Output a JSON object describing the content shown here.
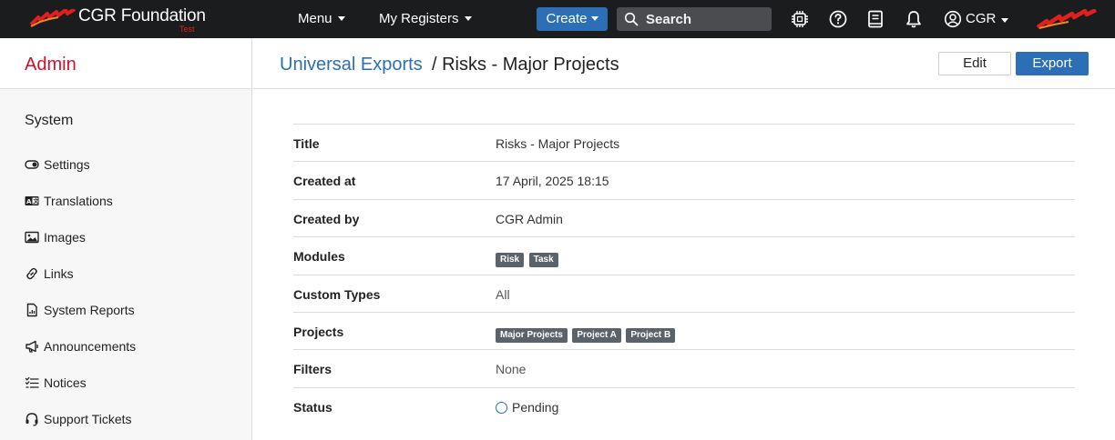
{
  "app": {
    "brand_name": "CGR Foundation",
    "brand_env": "Test",
    "colors": {
      "accent": "#2c6fb7",
      "brand_red": "#d0112b",
      "navbar": "#1b1c1e",
      "badge": "#5b6269"
    }
  },
  "navbar": {
    "menu_label": "Menu",
    "registers_label": "My Registers",
    "create_label": "Create",
    "search_label": "Search",
    "user_label": "CGR",
    "icons": [
      "chip-icon",
      "help-icon",
      "book-icon",
      "bell-icon",
      "user-circle-icon"
    ]
  },
  "sidebar": {
    "title": "Admin",
    "section": "System",
    "items": [
      {
        "label": "Settings",
        "icon": "toggle-icon"
      },
      {
        "label": "Translations",
        "icon": "translate-icon"
      },
      {
        "label": "Images",
        "icon": "image-icon"
      },
      {
        "label": "Links",
        "icon": "link-icon"
      },
      {
        "label": "System Reports",
        "icon": "report-icon"
      },
      {
        "label": "Announcements",
        "icon": "megaphone-icon"
      },
      {
        "label": "Notices",
        "icon": "checklist-icon"
      },
      {
        "label": "Support Tickets",
        "icon": "headset-icon"
      }
    ]
  },
  "header": {
    "breadcrumb_link": "Universal Exports",
    "breadcrumb_current": "/ Risks - Major Projects",
    "edit_label": "Edit",
    "export_label": "Export"
  },
  "details": {
    "title": {
      "label": "Title",
      "value": "Risks - Major Projects"
    },
    "created_at": {
      "label": "Created at",
      "value": "17 April, 2025 18:15"
    },
    "created_by": {
      "label": "Created by",
      "value": "CGR Admin"
    },
    "modules": {
      "label": "Modules",
      "values": [
        "Risk",
        "Task"
      ]
    },
    "custom_types": {
      "label": "Custom Types",
      "value": "All"
    },
    "projects": {
      "label": "Projects",
      "values": [
        "Major Projects",
        "Project A",
        "Project B"
      ]
    },
    "filters": {
      "label": "Filters",
      "value": "None"
    },
    "status": {
      "label": "Status",
      "value": "Pending"
    }
  }
}
